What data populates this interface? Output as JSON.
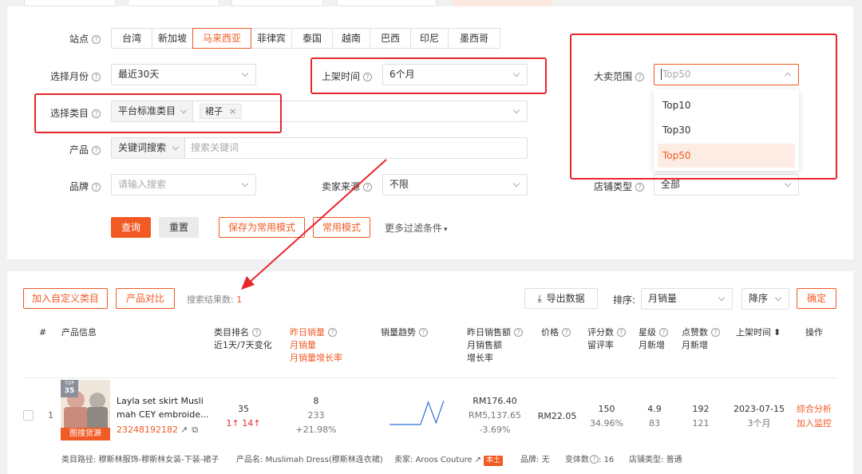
{
  "filters": {
    "site": {
      "label": "站点",
      "options": [
        "台湾",
        "新加坡",
        "马来西亚",
        "菲律宾",
        "泰国",
        "越南",
        "巴西",
        "印尼",
        "墨西哥"
      ],
      "selected": "马来西亚"
    },
    "month": {
      "label": "选择月份",
      "value": "最近30天"
    },
    "list_time": {
      "label": "上架时间",
      "value": "6个月"
    },
    "category": {
      "label": "选择类目",
      "type_value": "平台标准类目",
      "tag": "裙子"
    },
    "product": {
      "label": "产品",
      "mode": "关键词搜索",
      "placeholder": "搜索关键词"
    },
    "brand": {
      "label": "品牌",
      "placeholder": "请输入搜索"
    },
    "seller_source": {
      "label": "卖家来源",
      "value": "不限"
    },
    "bestseller": {
      "label": "大卖范围",
      "placeholder": "Top50",
      "options": [
        "Top10",
        "Top30",
        "Top50"
      ],
      "selected": "Top50"
    },
    "shop_type": {
      "label": "店铺类型",
      "value": "全部"
    }
  },
  "actions": {
    "query": "查询",
    "reset": "重置",
    "save_mode": "保存为常用模式",
    "common_mode": "常用模式",
    "more_filters": "更多过滤条件"
  },
  "results_toolbar": {
    "add_custom": "加入自定义类目",
    "compare": "产品对比",
    "count_label": "搜索结果数:",
    "count": "1",
    "export": "导出数据",
    "sort_label": "排序:",
    "sort_value": "月销量",
    "order_value": "降序",
    "confirm": "确定"
  },
  "columns": {
    "index": "#",
    "product_info": "产品信息",
    "rank": [
      "类目排名",
      "近1天/7天变化"
    ],
    "sales": [
      "昨日销量",
      "月销量",
      "月销量增长率"
    ],
    "trend": "销量趋势",
    "revenue": [
      "昨日销售额",
      "月销售额",
      "增长率"
    ],
    "price": "价格",
    "reviews": [
      "评分数",
      "留评率"
    ],
    "rating": [
      "星级",
      "月新增"
    ],
    "likes": [
      "点赞数",
      "月新增"
    ],
    "listed": "上架时间",
    "ops": "操作"
  },
  "rows": [
    {
      "index": "1",
      "badge_top": "TOP",
      "badge_num": "35",
      "image_tag": "图搜货源",
      "title_l1": "Layla set skirt Musli",
      "title_l2": "mah CEY embroide...",
      "product_id": "23248192182",
      "rank": "35",
      "rank_change_1d": "1",
      "rank_change_7d": "14",
      "sales_yesterday": "8",
      "sales_month": "233",
      "sales_growth": "+21.98%",
      "revenue_yesterday": "RM176.40",
      "revenue_month": "RM5,137.65",
      "revenue_growth": "-3.69%",
      "price": "RM22.05",
      "reviews": "150",
      "review_rate": "34.96%",
      "rating": "4.9",
      "rating_new": "83",
      "likes": "192",
      "likes_new": "121",
      "listed_date": "2023-07-15",
      "listed_age": "3个月",
      "op_analysis": "综合分析",
      "op_monitor": "加入监控",
      "trend": [
        0.15,
        0.15,
        0.15,
        0.15,
        0.15,
        0.85,
        0.2,
        0.9
      ],
      "meta": {
        "path_label": "类目路径:",
        "path": "穆斯林服饰-穆斯林女装-下装-裙子",
        "name_label": "产品名:",
        "name": "Muslimah Dress(穆斯林连衣裙)",
        "seller_label": "卖家:",
        "seller": "Aroos Couture",
        "local_tag": "本土",
        "brand_label": "品牌:",
        "brand": "无",
        "variants_label": "变体数",
        "variants": "16",
        "shop_label": "店铺类型:",
        "shop": "普通"
      }
    }
  ],
  "colors": {
    "accent": "#f15a24",
    "annotation": "#e8262b",
    "up": "#e8262b",
    "trend_line": "#2f6fd6"
  }
}
